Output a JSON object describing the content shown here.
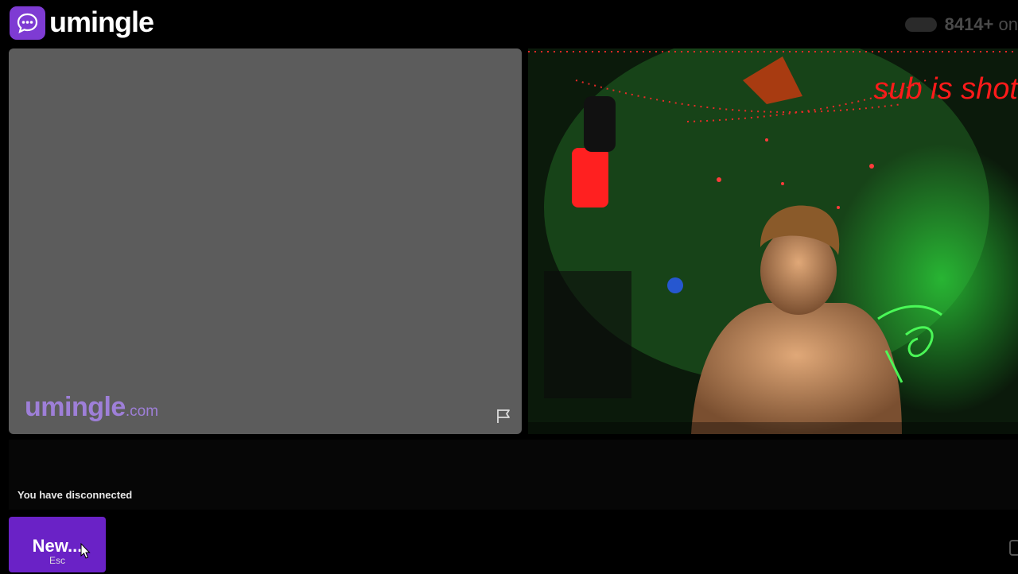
{
  "header": {
    "logo_text": "umingle",
    "logo_icon": "chat-bubble-icon",
    "online_count": "8414+",
    "online_suffix": "on"
  },
  "self_video": {
    "watermark": "umingle",
    "watermark_suffix": ".com",
    "report_icon": "flag-icon"
  },
  "stranger_video": {
    "overlay_text": "sub is shot"
  },
  "chat": {
    "status_message": "You have disconnected",
    "input_placeholder": ""
  },
  "controls": {
    "new_label": "New...",
    "new_shortcut": "Esc"
  },
  "colors": {
    "brand_purple": "#7e3bd3",
    "button_purple": "#6a22c6",
    "overlay_red": "#ff1a1a"
  }
}
